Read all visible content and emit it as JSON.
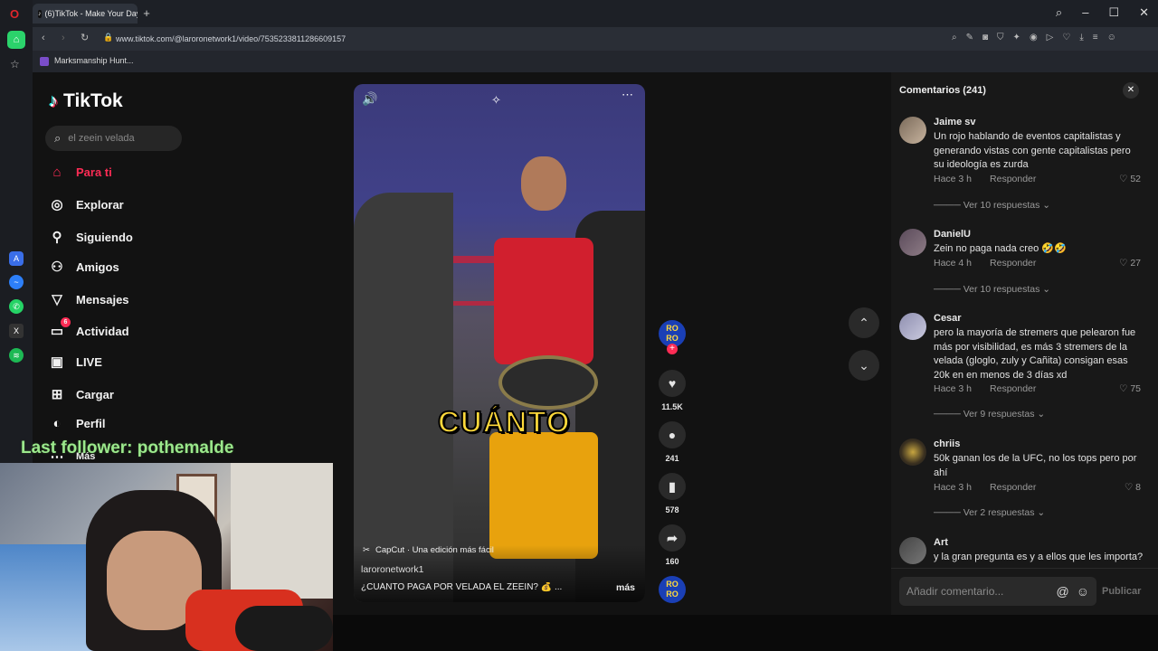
{
  "browser": {
    "tab_title": "(6)TikTok - Make Your Day",
    "url": "www.tiktok.com/@laroronetwork1/video/7535233811286609157",
    "bookmark": "Marksmanship Hunt..."
  },
  "tiktok": {
    "logo": "TikTok",
    "search_placeholder": "el zeein velada",
    "nav": [
      {
        "label": "Para ti",
        "icon": "home-icon",
        "active": true
      },
      {
        "label": "Explorar",
        "icon": "compass-icon"
      },
      {
        "label": "Siguiendo",
        "icon": "following-icon"
      },
      {
        "label": "Amigos",
        "icon": "friends-icon"
      },
      {
        "label": "Mensajes",
        "icon": "messages-icon"
      },
      {
        "label": "Actividad",
        "icon": "activity-icon",
        "badge": "6"
      },
      {
        "label": "LIVE",
        "icon": "live-icon"
      },
      {
        "label": "Cargar",
        "icon": "upload-icon"
      },
      {
        "label": "Perfil",
        "icon": "profile-icon"
      },
      {
        "label": "Más",
        "icon": "more-icon"
      }
    ],
    "video": {
      "overlay_word": "CUÁNTO",
      "capcut": "CapCut · Una edición más fácil",
      "author": "laroronetwork1",
      "description": "¿CUÁNTO PAGA POR VELADA EL ZEEIN? 💰 ...",
      "more": "más",
      "avatar_text": "RO\nRO"
    },
    "actions": {
      "likes": "11.5K",
      "comments": "241",
      "saves": "578",
      "shares": "160"
    }
  },
  "comments_panel": {
    "title": "Comentarios (241)",
    "reply_label": "Responder",
    "comments": [
      {
        "user": "Jaime sv",
        "text": "Un rojo hablando de eventos capitalistas y generando vistas con gente capitalistas pero su ideología es zurda",
        "time": "Hace 3 h",
        "likes": "52",
        "replies": "Ver 10 respuestas"
      },
      {
        "user": "DanielU",
        "text": "Zein no paga nada creo 🤣🤣",
        "time": "Hace 4 h",
        "likes": "27",
        "replies": "Ver 10 respuestas"
      },
      {
        "user": "Cesar",
        "text": "pero la mayoría de stremers que pelearon fue más por visibilidad, es más 3 stremers de la velada (gloglo, zuly y Cañita) consigan esas 20k en en menos de 3 días xd",
        "time": "Hace 3 h",
        "likes": "75",
        "replies": "Ver 9 respuestas"
      },
      {
        "user": "chriis",
        "text": "50k ganan los de la UFC, no los tops pero por ahí",
        "time": "Hace 3 h",
        "likes": "8",
        "replies": "Ver 2 respuestas"
      },
      {
        "user": "Art",
        "text": "y la gran pregunta es y a ellos que les importa?",
        "time": "",
        "likes": "",
        "replies": ""
      }
    ],
    "input_placeholder": "Añadir comentario...",
    "publish": "Publicar"
  },
  "overlay": {
    "last_follower": "Last follower: pothemalde"
  }
}
